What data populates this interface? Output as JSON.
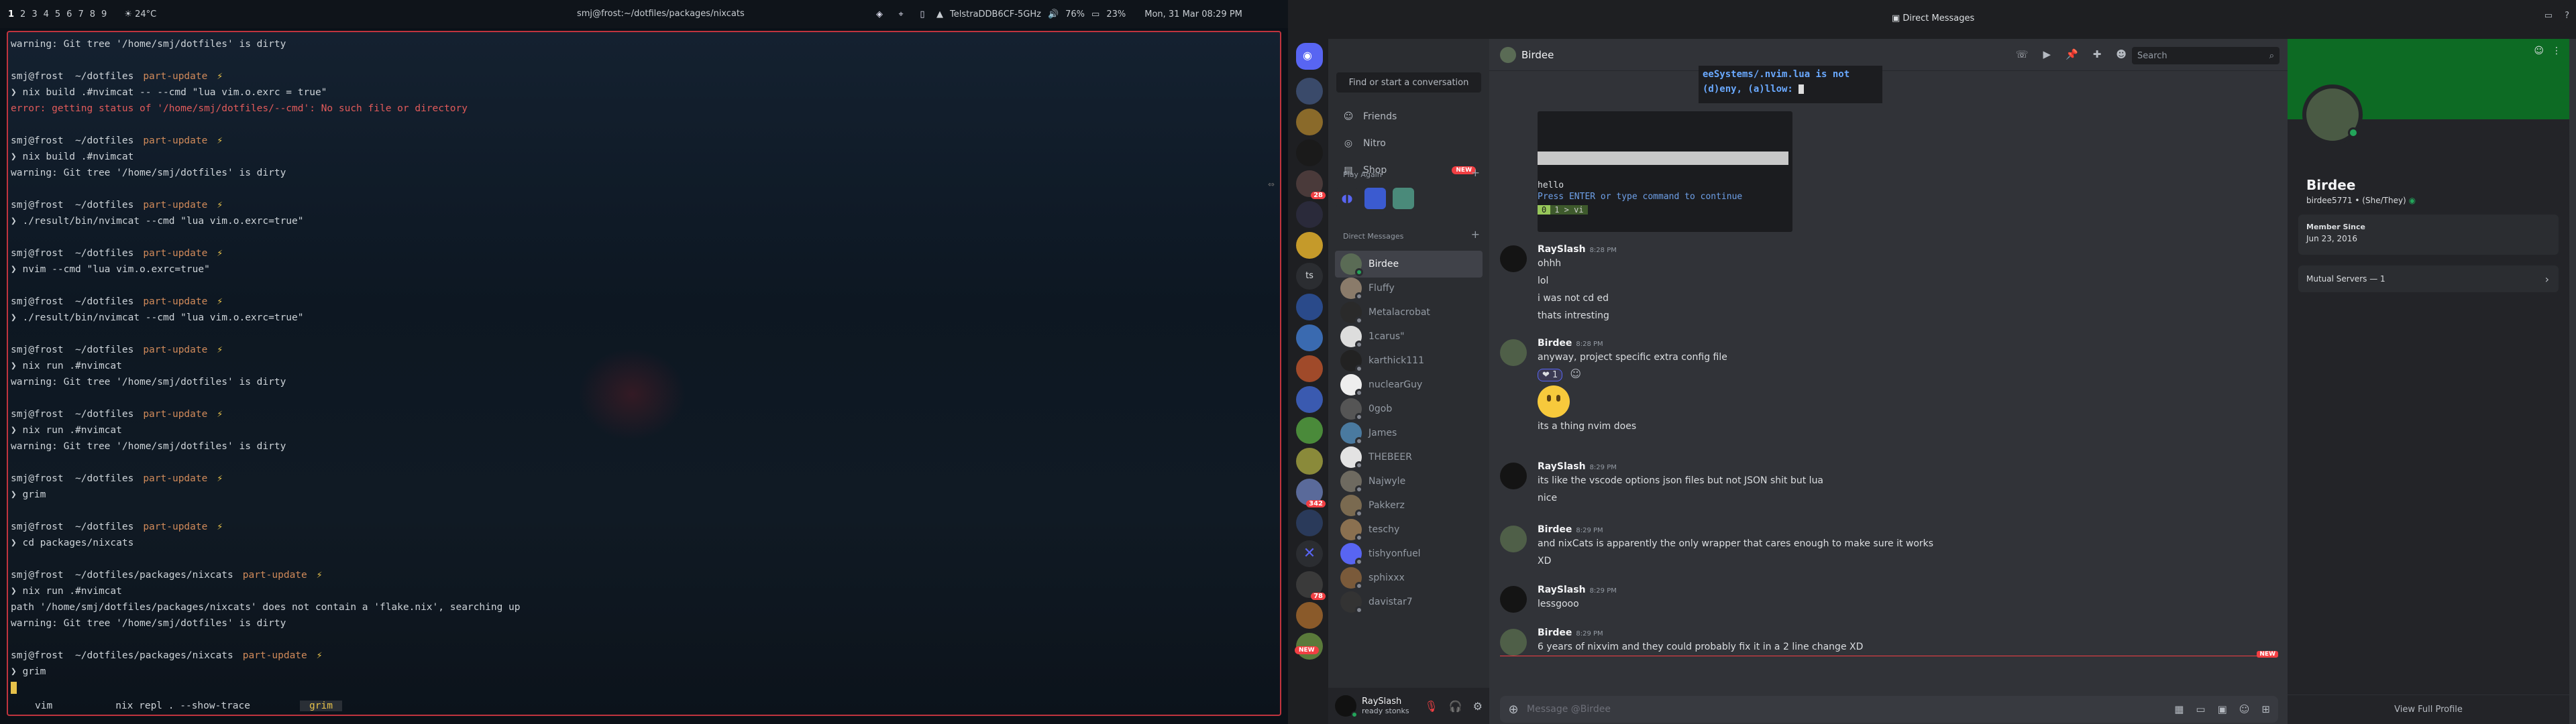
{
  "topbar": {
    "workspaces": [
      "1",
      "2",
      "3",
      "4",
      "5",
      "6",
      "7",
      "8",
      "9"
    ],
    "active_workspace": "1",
    "weather": "☀ 24°C",
    "window_title": "smj@frost:~/dotfiles/packages/nixcats",
    "wifi": "TelstraDDB6CF-5GHz",
    "volume": "76%",
    "battery": "23%",
    "datetime": "Mon, 31 Mar  08:29 PM"
  },
  "terminal": {
    "lines": [
      {
        "type": "warn",
        "text": "warning: Git tree '/home/smj/dotfiles' is dirty"
      },
      {
        "type": "blank"
      },
      {
        "type": "prompt",
        "path": "smj@frost  ~/dotfiles",
        "branch": "part-update",
        "bolt": "⚡"
      },
      {
        "type": "cmd",
        "text": "❯ nix build .#nvimcat -- --cmd \"lua vim.o.exrc = true\""
      },
      {
        "type": "error",
        "text": "error: getting status of '/home/smj/dotfiles/--cmd': No such file or directory"
      },
      {
        "type": "blank"
      },
      {
        "type": "prompt",
        "path": "smj@frost  ~/dotfiles",
        "branch": "part-update",
        "bolt": "⚡"
      },
      {
        "type": "cmd",
        "text": "❯ nix build .#nvimcat"
      },
      {
        "type": "warn",
        "text": "warning: Git tree '/home/smj/dotfiles' is dirty"
      },
      {
        "type": "blank"
      },
      {
        "type": "prompt",
        "path": "smj@frost  ~/dotfiles",
        "branch": "part-update",
        "bolt": "⚡"
      },
      {
        "type": "cmd",
        "text": "❯ ./result/bin/nvimcat --cmd \"lua vim.o.exrc=true\""
      },
      {
        "type": "blank"
      },
      {
        "type": "prompt",
        "path": "smj@frost  ~/dotfiles",
        "branch": "part-update",
        "bolt": "⚡"
      },
      {
        "type": "cmd",
        "text": "❯ nvim --cmd \"lua vim.o.exrc=true\""
      },
      {
        "type": "blank"
      },
      {
        "type": "prompt",
        "path": "smj@frost  ~/dotfiles",
        "branch": "part-update",
        "bolt": "⚡"
      },
      {
        "type": "cmd",
        "text": "❯ ./result/bin/nvimcat --cmd \"lua vim.o.exrc=true\""
      },
      {
        "type": "blank"
      },
      {
        "type": "prompt",
        "path": "smj@frost  ~/dotfiles",
        "branch": "part-update",
        "bolt": "⚡"
      },
      {
        "type": "cmd",
        "text": "❯ nix run .#nvimcat"
      },
      {
        "type": "warn",
        "text": "warning: Git tree '/home/smj/dotfiles' is dirty"
      },
      {
        "type": "blank"
      },
      {
        "type": "prompt",
        "path": "smj@frost  ~/dotfiles",
        "branch": "part-update",
        "bolt": "⚡"
      },
      {
        "type": "cmd",
        "text": "❯ nix run .#nvimcat"
      },
      {
        "type": "warn",
        "text": "warning: Git tree '/home/smj/dotfiles' is dirty"
      },
      {
        "type": "blank"
      },
      {
        "type": "prompt",
        "path": "smj@frost  ~/dotfiles",
        "branch": "part-update",
        "bolt": "⚡"
      },
      {
        "type": "cmd",
        "text": "❯ grim"
      },
      {
        "type": "blank"
      },
      {
        "type": "prompt",
        "path": "smj@frost  ~/dotfiles",
        "branch": "part-update",
        "bolt": "⚡"
      },
      {
        "type": "cmd",
        "text": "❯ cd packages/nixcats"
      },
      {
        "type": "blank"
      },
      {
        "type": "prompt",
        "path": "smj@frost  ~/dotfiles/packages/nixcats",
        "branch": "part-update",
        "bolt": "⚡"
      },
      {
        "type": "cmd",
        "text": "❯ nix run .#nvimcat"
      },
      {
        "type": "warn",
        "text": "path '/home/smj/dotfiles/packages/nixcats' does not contain a 'flake.nix', searching up"
      },
      {
        "type": "warn",
        "text": "warning: Git tree '/home/smj/dotfiles' is dirty"
      },
      {
        "type": "blank"
      },
      {
        "type": "prompt",
        "path": "smj@frost  ~/dotfiles/packages/nixcats",
        "branch": "part-update",
        "bolt": "⚡"
      },
      {
        "type": "cmd",
        "text": "❯ grim"
      },
      {
        "type": "cursor"
      }
    ],
    "tabs": [
      "vim",
      "nix repl . --show-trace",
      "grim"
    ],
    "active_tab": "grim"
  },
  "discord": {
    "window_title": "Direct Messages",
    "search_placeholder": "Find or start a conversation",
    "nav": [
      {
        "label": "Friends",
        "icon": "friends-icon"
      },
      {
        "label": "Nitro",
        "icon": "nitro-icon"
      },
      {
        "label": "Shop",
        "icon": "shop-icon",
        "badge": "NEW"
      }
    ],
    "play_again_label": "Play Again",
    "dm_header": "Direct Messages",
    "dms": [
      {
        "name": "Birdee",
        "color": "#5a6b55",
        "status": "#23a55a"
      },
      {
        "name": "Fluffy",
        "color": "#8a7b6a",
        "status": "#80848e"
      },
      {
        "name": "Metalacrobat",
        "color": "#2a2a2a",
        "status": "#80848e"
      },
      {
        "name": "1carus\"",
        "color": "#ddd",
        "status": "#80848e"
      },
      {
        "name": "karthick111",
        "color": "#222",
        "status": "#80848e"
      },
      {
        "name": "nuclearGuy",
        "color": "#eee",
        "status": "#80848e"
      },
      {
        "name": "0gob",
        "color": "#555",
        "status": "#80848e"
      },
      {
        "name": "James",
        "color": "#4a7aa0",
        "status": "#80848e"
      },
      {
        "name": "THEBEER",
        "color": "#e3e3e3",
        "status": "#80848e"
      },
      {
        "name": "Najwyle",
        "color": "#6e6a60",
        "status": "#80848e"
      },
      {
        "name": "Pakkerz",
        "color": "#7a6a50",
        "status": "#80848e"
      },
      {
        "name": "teschy",
        "color": "#8a7050",
        "status": "#80848e"
      },
      {
        "name": "tishyonfuel",
        "color": "#5865f2",
        "status": "#80848e"
      },
      {
        "name": "sphixxx",
        "color": "#7a5a3a",
        "status": "#80848e"
      },
      {
        "name": "davistar7",
        "color": "#333",
        "status": "#80848e"
      }
    ],
    "user": {
      "name": "RaySlash",
      "status": "ready stonks"
    },
    "servers_badges": {
      "s6": "28",
      "s15": "78",
      "s16": "342",
      "new": "NEW"
    },
    "chat": {
      "title": "Birdee",
      "search_placeholder": "Search",
      "embed": {
        "top_line1": "eeSystems/.nvim.lua is not",
        "top_line2": "(d)eny, (a)llow: ",
        "hello": "hello",
        "press": "Press ENTER or type command to continue",
        "status_a": "0",
        "status_b": "1 > vi"
      },
      "messages": [
        {
          "author": "RaySlash",
          "time": "8:28 PM",
          "lines": [
            "ohhh",
            "lol",
            "i was not cd ed",
            "thats intresting"
          ]
        },
        {
          "author": "Birdee",
          "time": "8:28 PM",
          "lines": [
            "anyway, project specific extra config file"
          ],
          "reaction": "❤ 1",
          "emoji": true,
          "after": "its a thing nvim does"
        },
        {
          "author": "RaySlash",
          "time": "8:29 PM",
          "lines": [
            "its like the vscode options json files but not JSON shit but lua",
            "nice"
          ]
        },
        {
          "author": "Birdee",
          "time": "8:29 PM",
          "lines": [
            "and nixCats is apparently the only wrapper that cares enough to make sure it works",
            "XD"
          ]
        },
        {
          "author": "RaySlash",
          "time": "8:29 PM",
          "lines": [
            "lessgooo"
          ]
        },
        {
          "author": "Birdee",
          "time": "8:29 PM",
          "lines": [
            "6 years of nixvim and they could probably fix it in a 2 line change XD"
          ]
        }
      ],
      "new_label": "NEW",
      "composer_placeholder": "Message @Birdee"
    },
    "profile": {
      "name": "Birdee",
      "tag": "birdee5771 • (She/They)",
      "member_since_label": "Member Since",
      "member_since": "Jun 23, 2016",
      "mutual": "Mutual Servers — 1",
      "view_full": "View Full Profile"
    }
  }
}
